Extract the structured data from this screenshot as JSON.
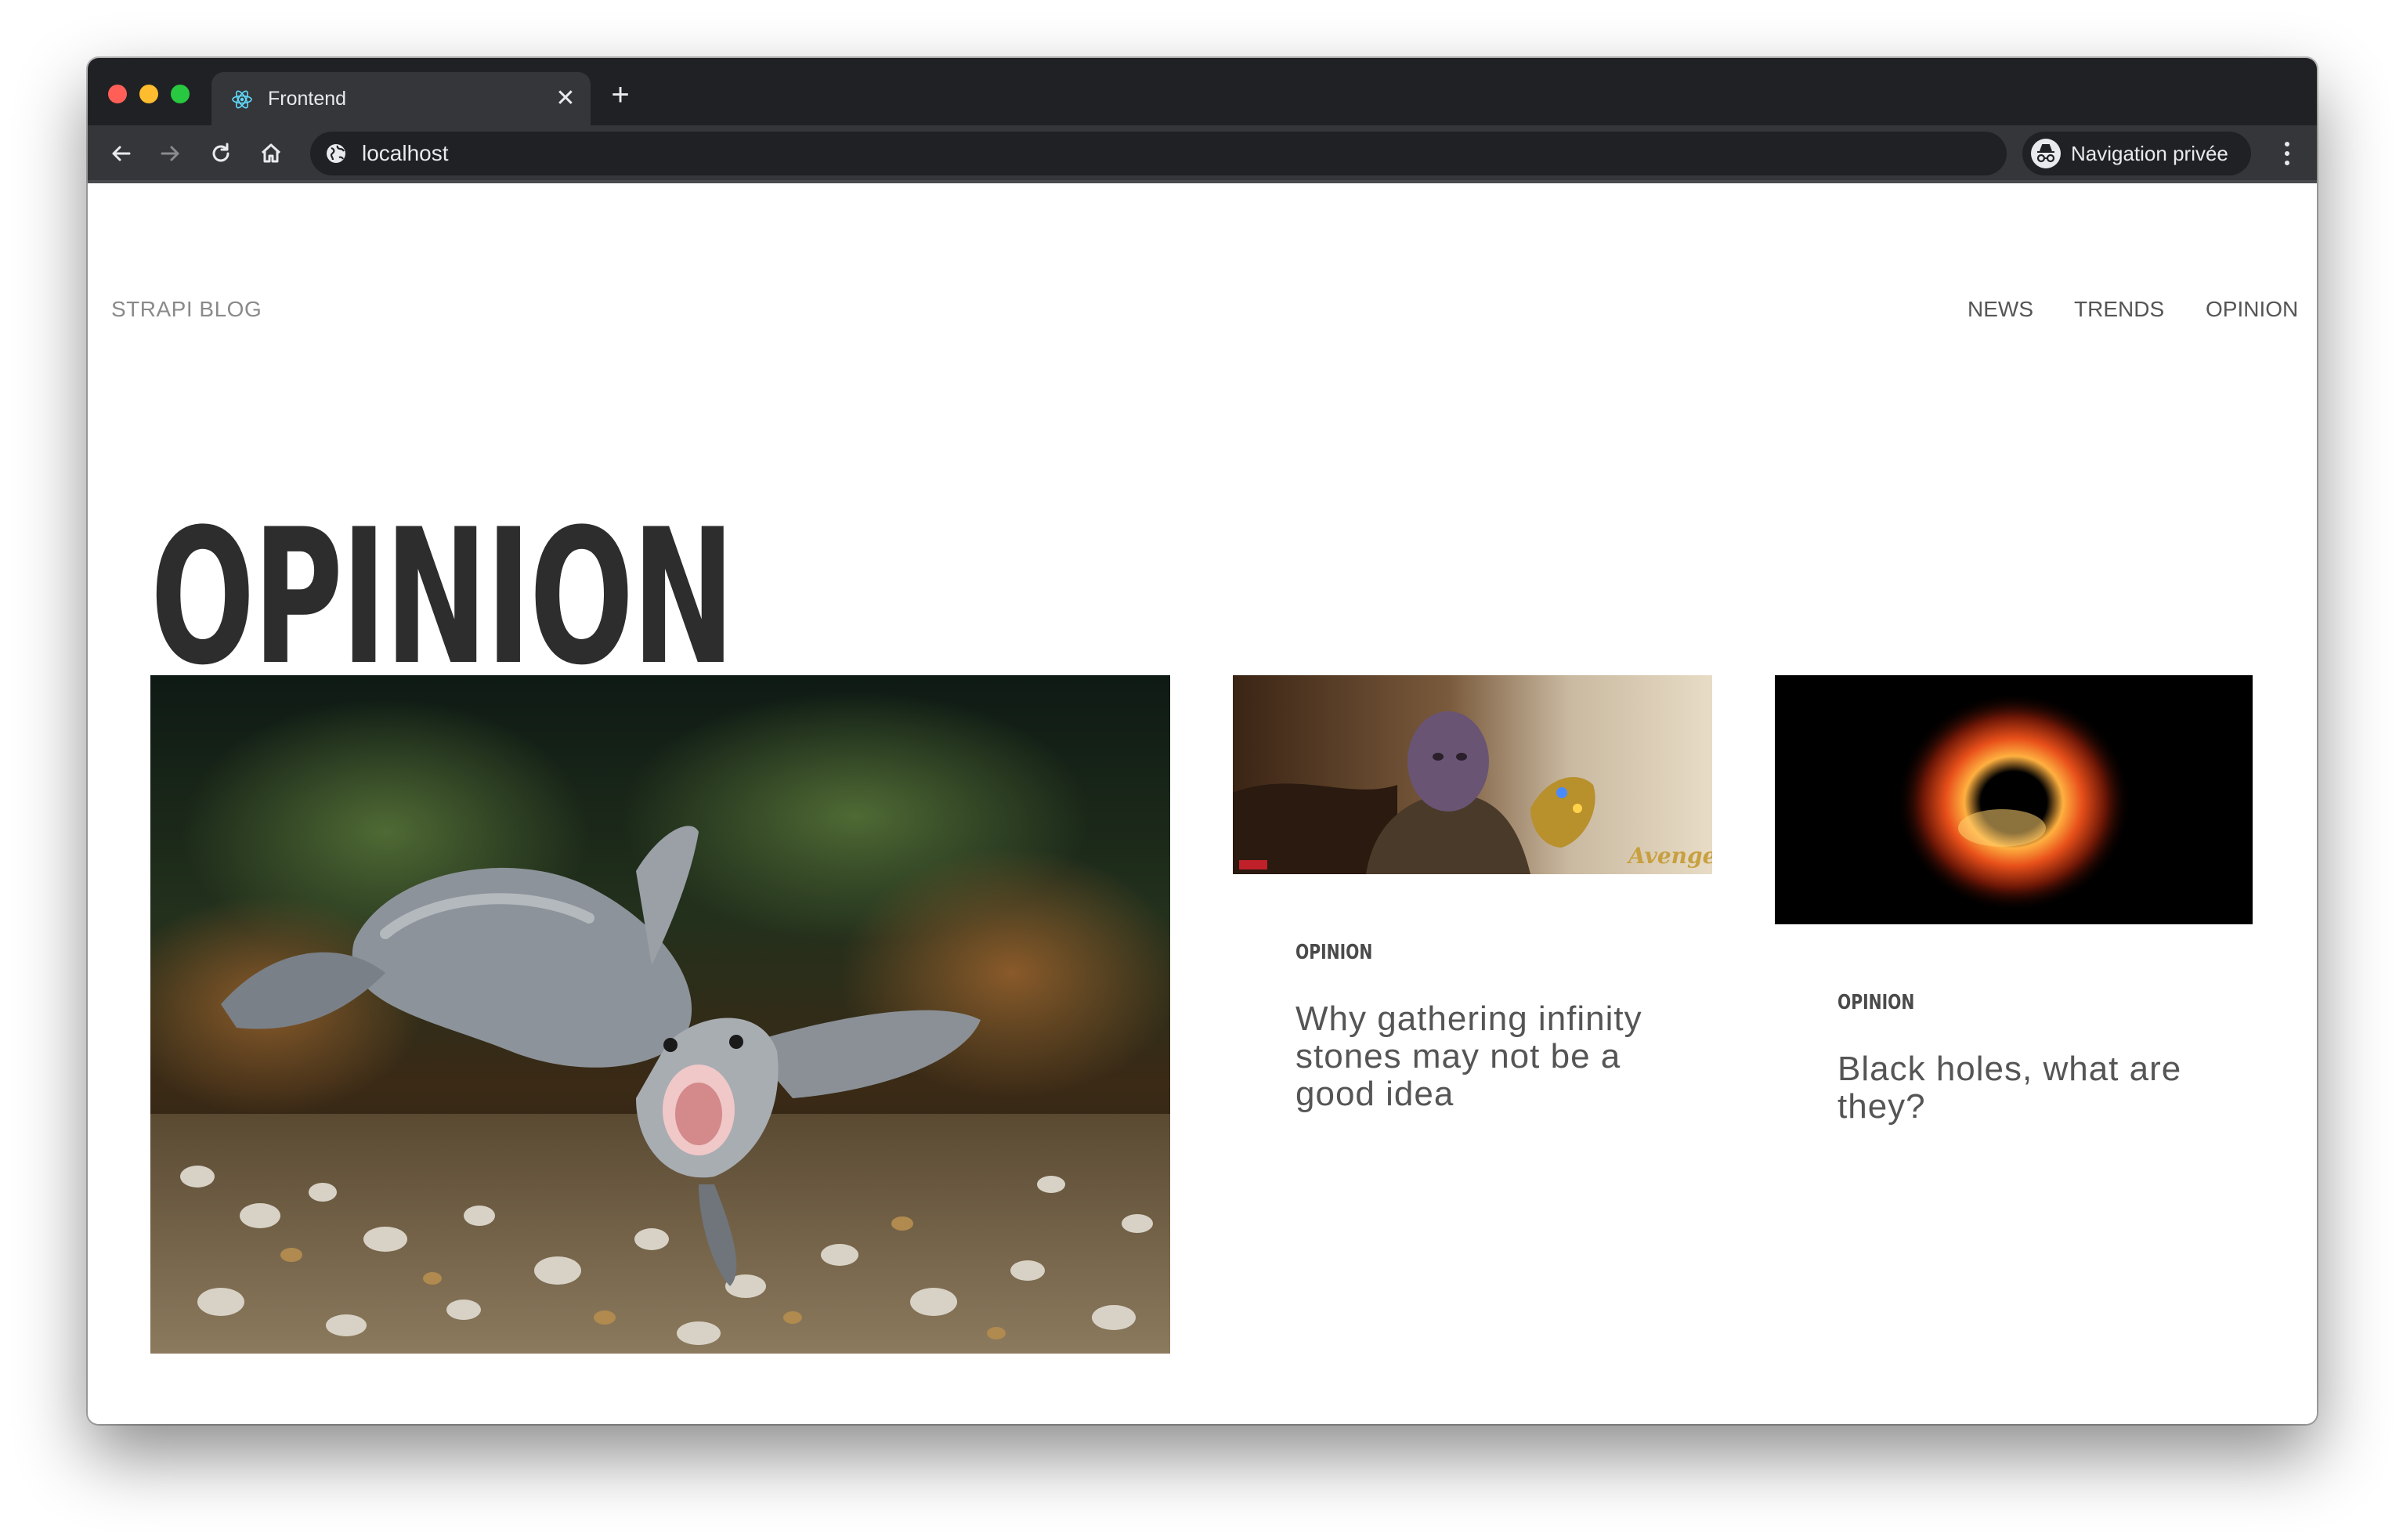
{
  "browser": {
    "tab_title": "Frontend",
    "tab_close_glyph": "✕",
    "new_tab_glyph": "+",
    "address": "localhost",
    "incognito_label": "Navigation privée",
    "icons": [
      "react-favicon",
      "back-arrow-icon",
      "forward-arrow-icon",
      "reload-icon",
      "home-icon",
      "globe-icon",
      "incognito-icon",
      "kebab-menu-icon"
    ],
    "colors": {
      "frame": "#202124",
      "toolbar": "#35363a",
      "text": "#e8eaed"
    }
  },
  "site": {
    "brand": "STRAPI BLOG",
    "nav": [
      "NEWS",
      "TRENDS",
      "OPINION"
    ]
  },
  "main": {
    "heading": "OPINION",
    "featured_image": "turtle-photo",
    "cards": [
      {
        "image": "thanos-photo",
        "category": "OPINION",
        "title": "Why gathering infinity stones may not be a good idea"
      },
      {
        "image": "black-hole-photo",
        "category": "OPINION",
        "title": "Black holes, what are they?"
      }
    ]
  },
  "colors": {
    "heading": "#2d2d2d",
    "body_text": "#555555",
    "muted": "#8a8a8a"
  }
}
